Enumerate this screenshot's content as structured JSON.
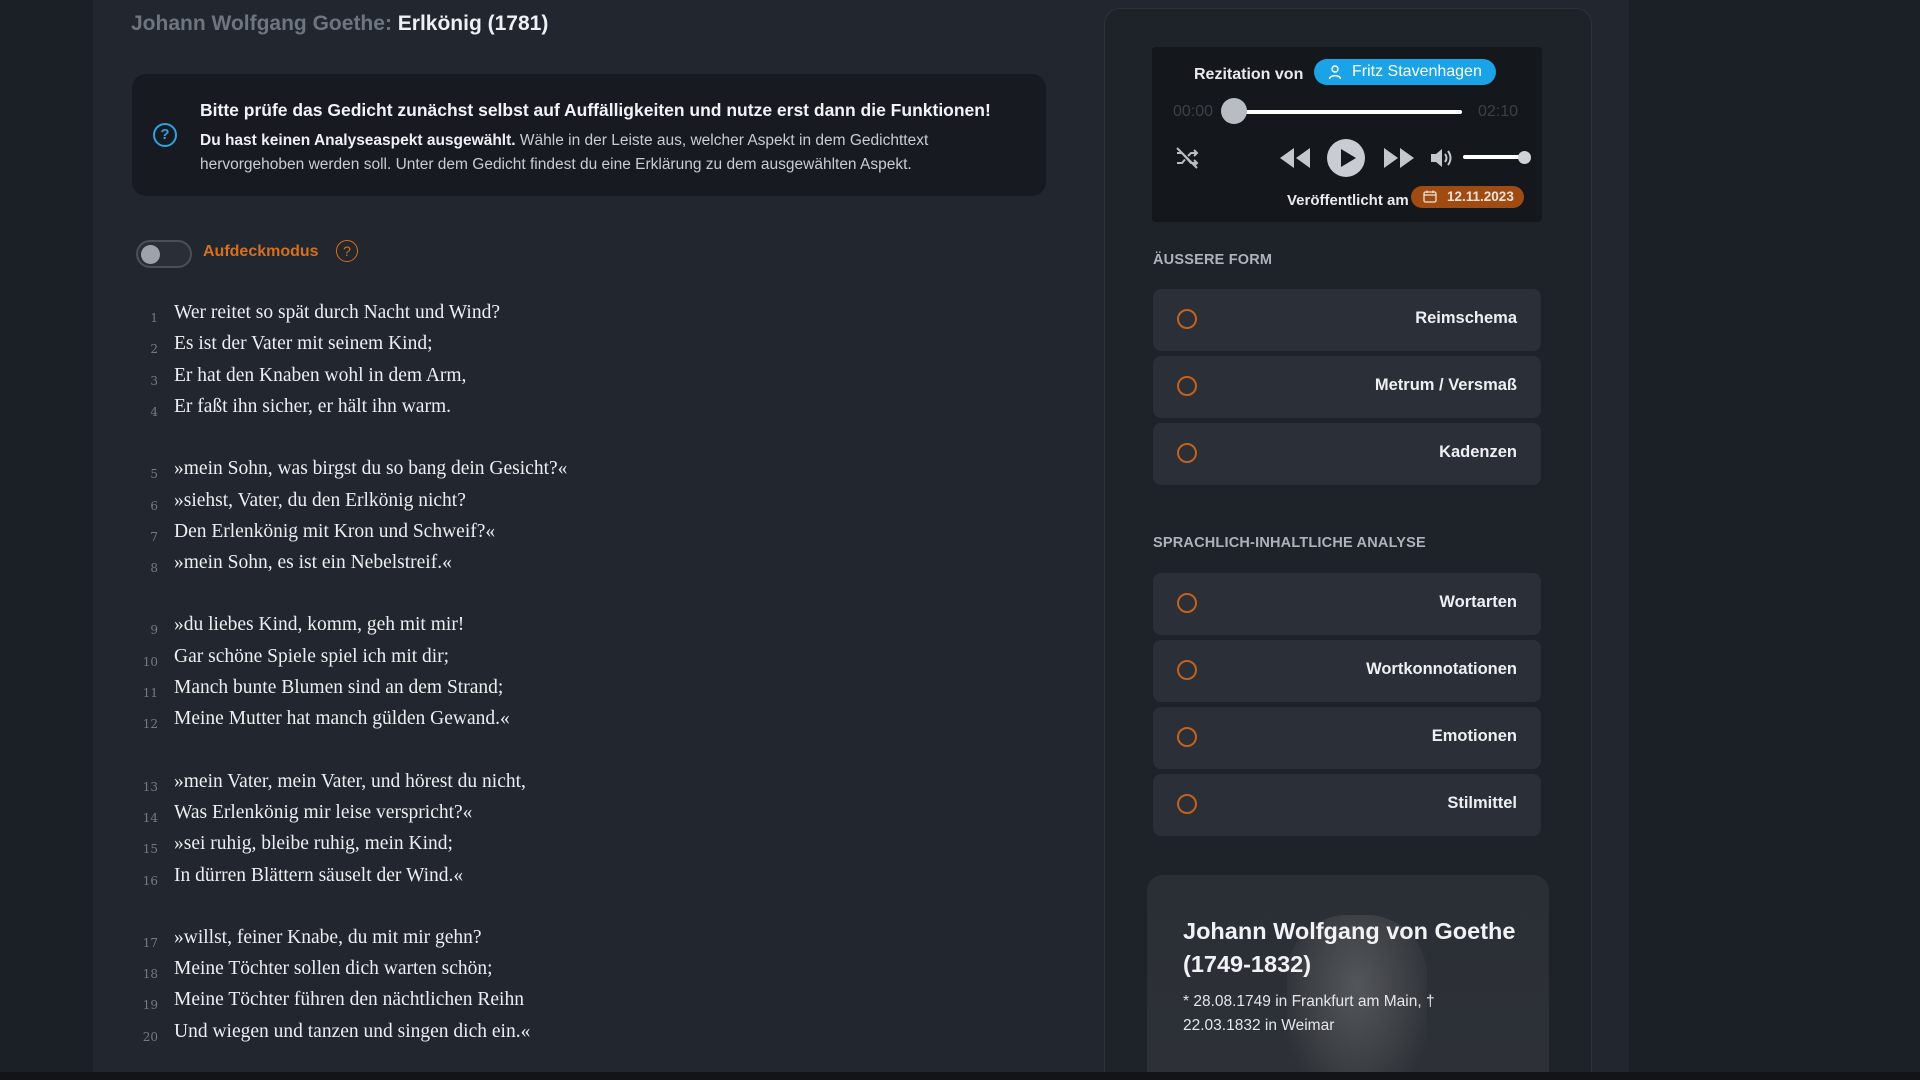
{
  "header": {
    "author": "Johann Wolfgang Goethe:",
    "work": "Erlkönig (1781)"
  },
  "notice": {
    "icon": "question-circle-icon",
    "headline": "Bitte prüfe das Gedicht zunächst selbst auf Auffälligkeiten und nutze erst dann die Funktionen!",
    "bold_text": "Du hast keinen Analyseaspekt ausgewählt.",
    "text": " Wähle in der Leiste aus, welcher Aspekt in dem Gedichttext hervorgehoben werden soll. Unter dem Gedicht findest du eine Erklärung zu dem ausgewählten Aspekt."
  },
  "reveal_mode": {
    "label": "Aufdeckmodus",
    "enabled": false,
    "help_icon": "?"
  },
  "poem": {
    "lines": [
      {
        "num": "1",
        "text": "Wer reitet so spät durch Nacht und Wind?"
      },
      {
        "num": "2",
        "text": "Es ist der Vater mit seinem Kind;"
      },
      {
        "num": "3",
        "text": "Er hat den Knaben wohl in dem Arm,"
      },
      {
        "num": "4",
        "text": "Er faßt ihn sicher, er hält ihn warm."
      },
      {
        "num": "5",
        "text": "»mein Sohn, was birgst du so bang dein Gesicht?«"
      },
      {
        "num": "6",
        "text": "»siehst, Vater, du den Erlkönig nicht?"
      },
      {
        "num": "7",
        "text": "Den Erlenkönig mit Kron und Schweif?«"
      },
      {
        "num": "8",
        "text": "»mein Sohn, es ist ein Nebelstreif.«"
      },
      {
        "num": "9",
        "text": "»du liebes Kind, komm, geh mit mir!"
      },
      {
        "num": "10",
        "text": "Gar schöne Spiele spiel ich mit dir;"
      },
      {
        "num": "11",
        "text": "Manch bunte Blumen sind an dem Strand;"
      },
      {
        "num": "12",
        "text": "Meine Mutter hat manch gülden Gewand.«"
      },
      {
        "num": "13",
        "text": "»mein Vater, mein Vater, und hörest du nicht,"
      },
      {
        "num": "14",
        "text": "Was Erlenkönig mir leise verspricht?«"
      },
      {
        "num": "15",
        "text": "»sei ruhig, bleibe ruhig, mein Kind;"
      },
      {
        "num": "16",
        "text": "In dürren Blättern säuselt der Wind.«"
      },
      {
        "num": "17",
        "text": "»willst, feiner Knabe, du mit mir gehn?"
      },
      {
        "num": "18",
        "text": "Meine Töchter sollen dich warten schön;"
      },
      {
        "num": "19",
        "text": "Meine Töchter führen den nächtlichen Reihn"
      },
      {
        "num": "20",
        "text": "Und wiegen und tanzen und singen dich ein.«"
      }
    ]
  },
  "player": {
    "recitation_label": "Rezitation von",
    "narrator": "Fritz Stavenhagen",
    "time_current": "00:00",
    "time_total": "02:10",
    "progress": 0,
    "volume": 0.85,
    "published_label": "Veröffentlicht am",
    "published_date": "12.11.2023",
    "icons": [
      "shuffle-off-icon",
      "rewind-icon",
      "play-icon",
      "fast-forward-icon",
      "volume-icon",
      "calendar-icon",
      "person-icon"
    ]
  },
  "sidebar": {
    "section_form": "ÄUSSERE FORM",
    "form_items": [
      {
        "label": "Reimschema"
      },
      {
        "label": "Metrum / Versmaß"
      },
      {
        "label": "Kadenzen"
      }
    ],
    "section_analysis": "SPRACHLICH-INHALTLICHE ANALYSE",
    "analysis_items": [
      {
        "label": "Wortarten"
      },
      {
        "label": "Wortkonnotationen"
      },
      {
        "label": "Emotionen"
      },
      {
        "label": "Stilmittel"
      }
    ]
  },
  "author_card": {
    "name": "Johann Wolfgang von Goethe (1749-1832)",
    "life": "* 28.08.1749 in Frankfurt am Main, † 22.03.1832 in Weimar"
  },
  "colors": {
    "accent_blue": "#1aa3e6",
    "accent_orange": "#d4701e",
    "date_badge": "#a04b12",
    "background": "#22262e"
  }
}
